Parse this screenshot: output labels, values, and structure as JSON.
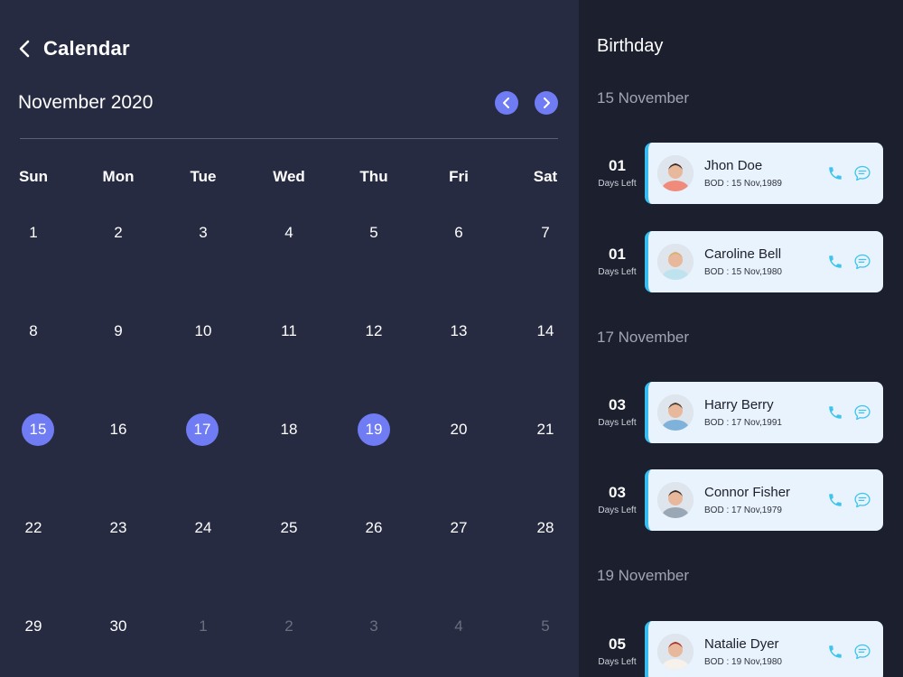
{
  "header": {
    "title": "Calendar"
  },
  "calendar": {
    "month_label": "November 2020",
    "weekdays": [
      "Sun",
      "Mon",
      "Tue",
      "Wed",
      "Thu",
      "Fri",
      "Sat"
    ],
    "weeks": [
      [
        {
          "n": "1"
        },
        {
          "n": "2"
        },
        {
          "n": "3"
        },
        {
          "n": "4"
        },
        {
          "n": "5"
        },
        {
          "n": "6"
        },
        {
          "n": "7"
        }
      ],
      [
        {
          "n": "8"
        },
        {
          "n": "9"
        },
        {
          "n": "10"
        },
        {
          "n": "11"
        },
        {
          "n": "12"
        },
        {
          "n": "13"
        },
        {
          "n": "14"
        }
      ],
      [
        {
          "n": "15",
          "selected": true
        },
        {
          "n": "16"
        },
        {
          "n": "17",
          "selected": true
        },
        {
          "n": "18"
        },
        {
          "n": "19",
          "selected": true
        },
        {
          "n": "20"
        },
        {
          "n": "21"
        }
      ],
      [
        {
          "n": "22"
        },
        {
          "n": "23"
        },
        {
          "n": "24"
        },
        {
          "n": "25"
        },
        {
          "n": "26"
        },
        {
          "n": "27"
        },
        {
          "n": "28"
        }
      ],
      [
        {
          "n": "29"
        },
        {
          "n": "30"
        },
        {
          "n": "1",
          "muted": true
        },
        {
          "n": "2",
          "muted": true
        },
        {
          "n": "3",
          "muted": true
        },
        {
          "n": "4",
          "muted": true
        },
        {
          "n": "5",
          "muted": true
        }
      ]
    ]
  },
  "birthday": {
    "title": "Birthday",
    "groups": [
      {
        "date": "15 November",
        "entries": [
          {
            "days": "01",
            "days_caption": "Days Left",
            "name": "Jhon Doe",
            "bod": "BOD : 15 Nov,1989"
          },
          {
            "days": "01",
            "days_caption": "Days Left",
            "name": "Caroline Bell",
            "bod": "BOD : 15 Nov,1980"
          }
        ]
      },
      {
        "date": "17 November",
        "entries": [
          {
            "days": "03",
            "days_caption": "Days Left",
            "name": "Harry Berry",
            "bod": "BOD : 17 Nov,1991"
          },
          {
            "days": "03",
            "days_caption": "Days Left",
            "name": "Connor Fisher",
            "bod": "BOD : 17 Nov,1979"
          }
        ]
      },
      {
        "date": "19 November",
        "entries": [
          {
            "days": "05",
            "days_caption": "Days Left",
            "name": "Natalie Dyer",
            "bod": "BOD : 19 Nov,1980"
          }
        ]
      }
    ]
  },
  "colors": {
    "accent": "#6f7cf3",
    "card_bg": "#e9f3fd",
    "card_stripe": "#38bdf0",
    "icon": "#3fc4ee"
  }
}
